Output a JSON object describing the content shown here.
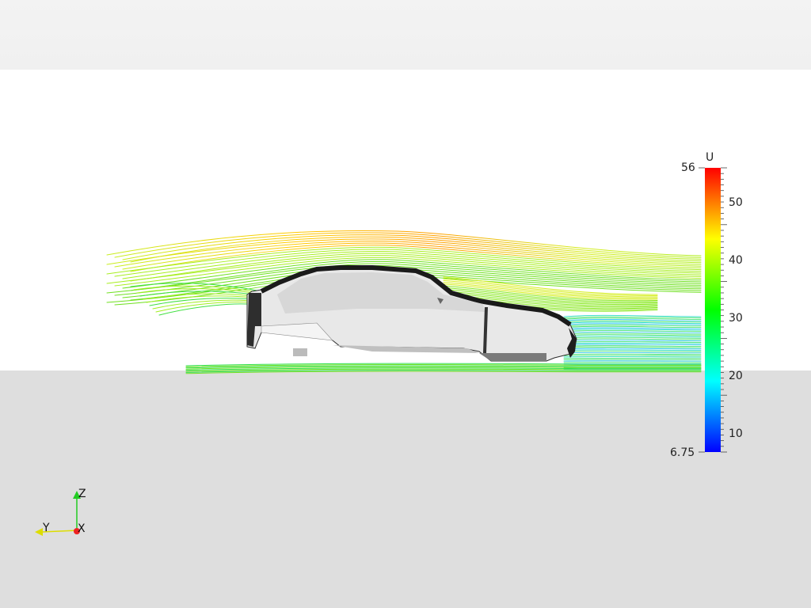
{
  "scene": {
    "background_color": "#ffffff",
    "top_band_color": "#f1f1f1",
    "ground_color": "#dedede",
    "car_color": "#e6e6e6",
    "car_outline_color": "#1f1f1f"
  },
  "colorbar": {
    "title": "U",
    "max_label": "56",
    "min_label": "6.75",
    "range": [
      6.75,
      56
    ],
    "ticks": [
      "50",
      "40",
      "30",
      "20",
      "10"
    ],
    "tick_values": [
      50,
      40,
      30,
      20,
      10
    ],
    "colors": [
      "#0000ff",
      "#00ffff",
      "#00ff00",
      "#ffff00",
      "#ff0000"
    ]
  },
  "orientation_axes": {
    "z_label": "Z",
    "y_label": "Y",
    "x_label": "X",
    "z_color": "#22cc22",
    "y_color": "#dddd00",
    "x_color": "#ee2222"
  }
}
